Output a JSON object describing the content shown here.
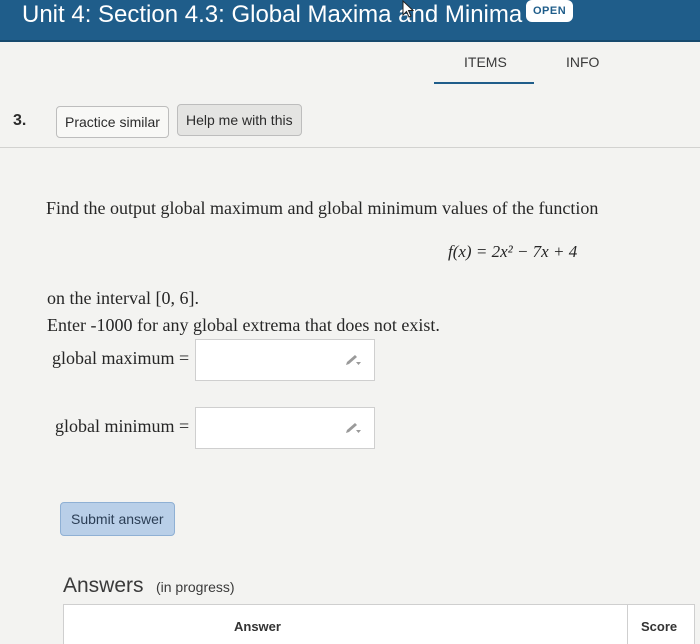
{
  "header": {
    "title": "Unit 4: Section 4.3: Global Maxima and Minima",
    "badge": "OPEN"
  },
  "tabs": [
    {
      "label": "ITEMS",
      "active": true
    },
    {
      "label": "INFO",
      "active": false
    }
  ],
  "question": {
    "number": "3.",
    "practice_label": "Practice similar",
    "help_label": "Help me with this",
    "prompt": "Find the output global maximum and global minimum values of the function",
    "formula": "f(x) = 2x² − 7x + 4",
    "interval": "on the interval [0, 6].",
    "instruction": "Enter -1000 for any global extrema that does not exist.",
    "max_label": "global maximum =",
    "min_label": "global minimum =",
    "max_value": "",
    "min_value": "",
    "submit_label": "Submit answer"
  },
  "answers": {
    "title": "Answers",
    "status": "(in progress)",
    "columns": [
      "Answer",
      "Score"
    ]
  },
  "colors": {
    "header_bg": "#1f5d8a",
    "submit_bg": "#b9cfe8",
    "page_bg": "#f3f3f1"
  },
  "icons": {
    "edit": "pencil-icon",
    "cursor": "mouse-cursor-icon"
  }
}
